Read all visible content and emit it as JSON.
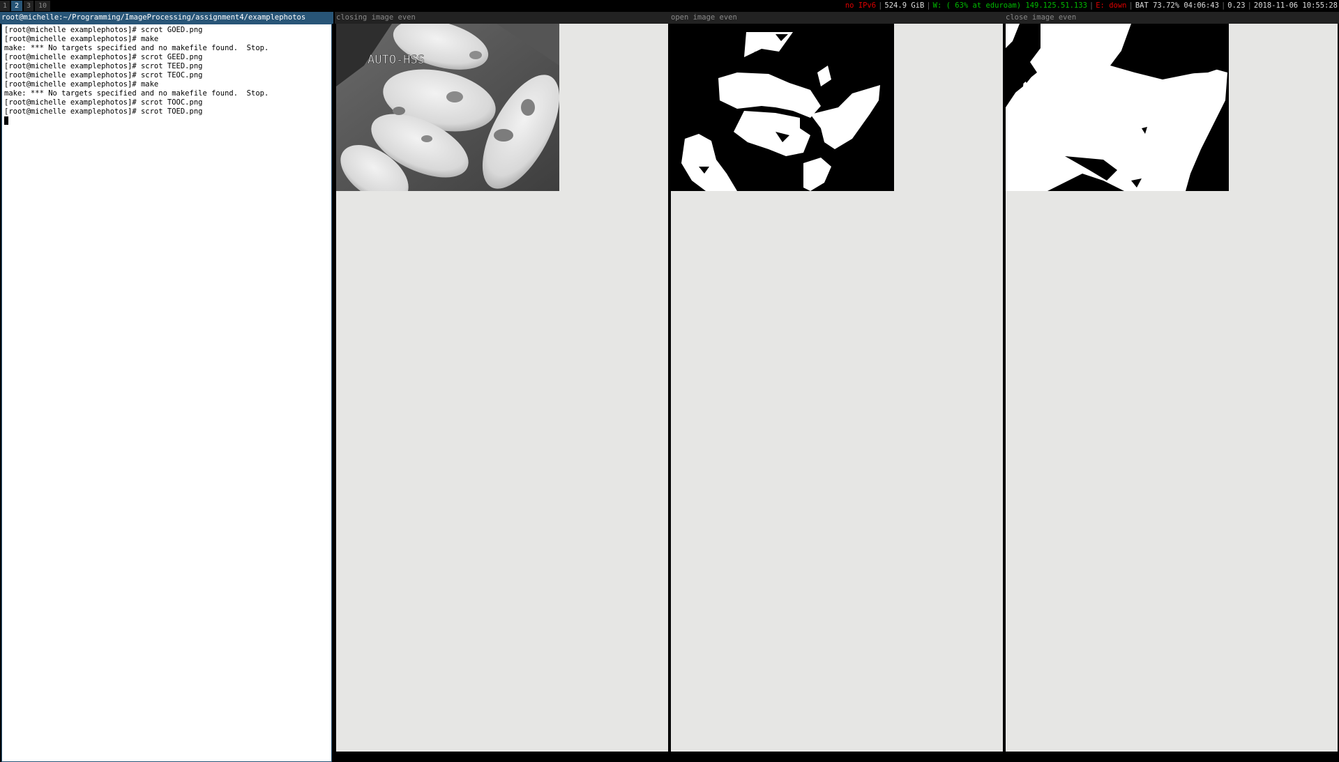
{
  "topbar": {
    "workspaces": [
      "1",
      "2",
      "3",
      "10"
    ],
    "active_workspace": "2",
    "status": {
      "ipv6": "no IPv6",
      "disk": "524.9 GiB",
      "wifi": "W: ( 63% at eduroam) 149.125.51.133",
      "ethernet": "E: down",
      "battery": "BAT 73.72% 04:06:43",
      "load": "0.23",
      "datetime": "2018-11-06 10:55:28"
    }
  },
  "terminal": {
    "title": "root@michelle:~/Programming/ImageProcessing/assignment4/examplephotos",
    "lines": [
      "[root@michelle examplephotos]# scrot GOED.png",
      "[root@michelle examplephotos]# make",
      "make: *** No targets specified and no makefile found.  Stop.",
      "[root@michelle examplephotos]# scrot GEED.png",
      "[root@michelle examplephotos]# scrot TEED.png",
      "[root@michelle examplephotos]# scrot TEOC.png",
      "[root@michelle examplephotos]# make",
      "make: *** No targets specified and no makefile found.  Stop.",
      "[root@michelle examplephotos]# scrot TOOC.png",
      "[root@michelle examplephotos]# scrot TOED.png"
    ]
  },
  "image_windows": [
    {
      "title": "closing image even",
      "overlay_text": "AUTO-HSS",
      "kind": "grayscale-photo"
    },
    {
      "title": "open image even",
      "kind": "binary-mask"
    },
    {
      "title": "close image even",
      "kind": "binary-mask"
    }
  ],
  "colors": {
    "focused_title_bg": "#285577",
    "unfocused_title_bg": "#222222",
    "image_window_bg": "#e6e6e4"
  }
}
